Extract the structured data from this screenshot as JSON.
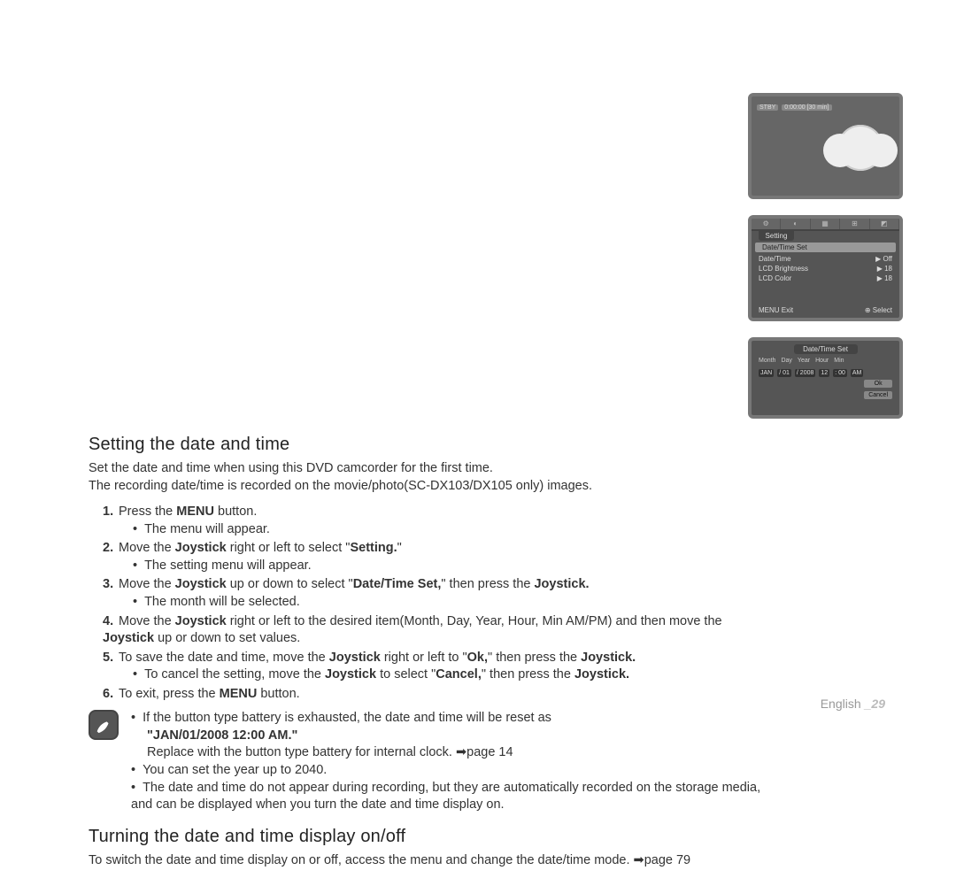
{
  "section1": {
    "heading": "Setting the date and time",
    "intro1": "Set the date and time when using this DVD camcorder for the first time.",
    "intro2": "The recording date/time is recorded on the movie/photo(SC-DX103/DX105 only) images."
  },
  "steps": {
    "s1a": "Press the ",
    "s1b": "MENU",
    "s1c": " button.",
    "s1sub": "The menu will appear.",
    "s2a": "Move the ",
    "s2b": "Joystick",
    "s2c": " right or left to select \"",
    "s2d": "Setting.",
    "s2e": "\"",
    "s2sub": "The setting menu will appear.",
    "s3a": "Move the ",
    "s3b": "Joystick",
    "s3c": " up or down to select \"",
    "s3d": "Date/Time Set,",
    "s3e": "\" then press the ",
    "s3f": "Joystick.",
    "s3sub": "The month will be selected.",
    "s4a": "Move the ",
    "s4b": "Joystick",
    "s4c": " right or left to the desired item(Month, Day, Year, Hour, Min AM/PM) and then move the ",
    "s4d": "Joystick",
    "s4e": " up or down to set values.",
    "s5a": "To save the date and time, move the ",
    "s5b": "Joystick",
    "s5c": " right or left to \"",
    "s5d": "Ok,",
    "s5e": "\" then press the ",
    "s5f": "Joystick.",
    "s5sub_a": "To cancel the setting, move the ",
    "s5sub_b": "Joystick",
    "s5sub_c": " to select \"",
    "s5sub_d": "Cancel,",
    "s5sub_e": "\" then press the ",
    "s5sub_f": "Joystick.",
    "s6a": "To exit, press the ",
    "s6b": "MENU",
    "s6c": " button."
  },
  "notes": {
    "n1a": "If the button type battery is exhausted, the date and time will be reset as",
    "n1b": "\"JAN/01/2008 12:00 AM.\"",
    "n1c": "Replace with the button type battery for internal clock. ➡page 14",
    "n2": "You can set the year up to 2040.",
    "n3": "The date and time do not appear during recording, but they are automatically recorded on the storage media, and can be displayed when you turn the date and time display on."
  },
  "section2": {
    "heading": "Turning the date and time display on/off",
    "body": "To switch the date and time display on or off, access the menu and change the date/time mode. ➡page 79"
  },
  "screens": {
    "s1": {
      "stby": "STBY",
      "time": "0:00:00 [30 min]"
    },
    "s2": {
      "tab": "Setting",
      "r1a": "Date/Time Set",
      "r2a": "Date/Time",
      "r2b": "▶ Off",
      "r3a": "LCD Brightness",
      "r3b": "▶ 18",
      "r4a": "LCD Color",
      "r4b": "▶ 18",
      "fL": "MENU Exit",
      "fR": "⊕ Select"
    },
    "s3": {
      "title": "Date/Time Set",
      "h1": "Month",
      "h2": "Day",
      "h3": "Year",
      "h4": "Hour",
      "h5": "Min",
      "v1": "JAN",
      "v2": "/ 01",
      "v3": "/ 2008",
      "v4": "12",
      "v5": ": 00",
      "v6": "AM",
      "ok": "Ok",
      "cancel": "Cancel"
    }
  },
  "footer": {
    "lang": "English",
    "page": "_29"
  },
  "nums": {
    "n1": "1.",
    "n2": "2.",
    "n3": "3.",
    "n4": "4.",
    "n5": "5.",
    "n6": "6."
  }
}
